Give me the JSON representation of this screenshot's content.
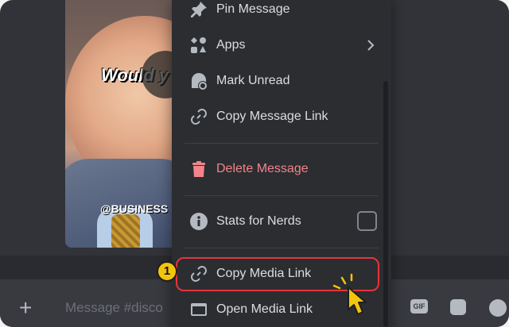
{
  "video": {
    "caption_text": "Would y",
    "handle_text": "@BUSINESS"
  },
  "menu": {
    "items": [
      {
        "label": "Pin Message",
        "icon": "pin-icon"
      },
      {
        "label": "Apps",
        "icon": "apps-icon",
        "has_submenu": true
      },
      {
        "label": "Mark Unread",
        "icon": "mark-unread-icon"
      },
      {
        "label": "Copy Message Link",
        "icon": "link-icon"
      },
      {
        "label": "Delete Message",
        "icon": "trash-icon",
        "danger": true
      },
      {
        "label": "Stats for Nerds",
        "icon": "info-icon",
        "checkbox": false
      },
      {
        "label": "Copy Media Link",
        "icon": "link-icon",
        "highlighted": true
      },
      {
        "label": "Open Media Link",
        "icon": "window-icon"
      }
    ]
  },
  "composer": {
    "placeholder": "Message #disco",
    "gif_label": "GIF"
  },
  "annotation": {
    "step_number": "1",
    "highlight_color": "#e8333b",
    "badge_color": "#f3c40c"
  },
  "colors": {
    "menu_bg": "#2b2d31",
    "danger": "#f1858a",
    "text": "#dbdee1"
  }
}
